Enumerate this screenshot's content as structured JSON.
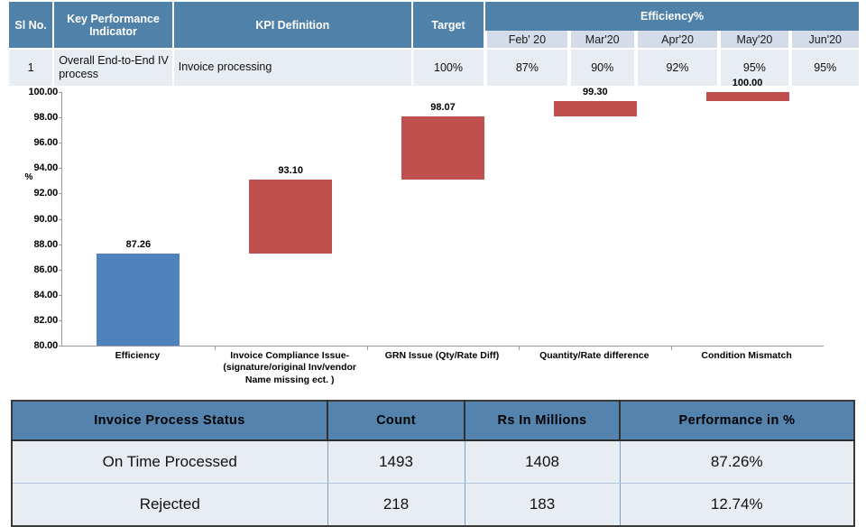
{
  "kpi_table": {
    "headers": {
      "sl_no": "Sl No.",
      "kpi": "Key Performance Indicator",
      "definition": "KPI Definition",
      "target": "Target",
      "efficiency_group": "Efficiency%"
    },
    "months": [
      "Feb' 20",
      "Mar'20",
      "Apr'20",
      "May'20",
      "Jun'20"
    ],
    "rows": [
      {
        "sl_no": "1",
        "kpi": "Overall End-to-End IV process",
        "definition": "Invoice processing",
        "target": "100%",
        "values": [
          "87%",
          "90%",
          "92%",
          "95%",
          "95%"
        ]
      }
    ]
  },
  "chart_data": {
    "type": "bar",
    "subtype": "waterfall",
    "title": "",
    "xlabel": "",
    "ylabel": "%",
    "ylim": [
      80.0,
      100.0
    ],
    "ytick_step": 2.0,
    "yticks": [
      "100.00",
      "98.00",
      "96.00",
      "94.00",
      "92.00",
      "90.00",
      "88.00",
      "86.00",
      "84.00",
      "82.00",
      "80.00"
    ],
    "grid": false,
    "legend": "none",
    "categories": [
      "Efficiency",
      "Invoice Compliance Issue-(signature/original Inv/vendor Name missing ect. )",
      "GRN Issue (Qty/Rate Diff)",
      "Quantity/Rate difference",
      "Condition Mismatch"
    ],
    "bars": [
      {
        "category": "Efficiency",
        "base": 80.0,
        "top": 87.26,
        "label": "87.26",
        "color": "#4F81BD",
        "kind": "total"
      },
      {
        "category": "Invoice Compliance Issue-(signature/original Inv/vendor Name missing ect. )",
        "base": 87.26,
        "top": 93.1,
        "label": "93.10",
        "color": "#C0504D",
        "kind": "delta"
      },
      {
        "category": "GRN Issue (Qty/Rate Diff)",
        "base": 93.1,
        "top": 98.07,
        "label": "98.07",
        "color": "#C0504D",
        "kind": "delta"
      },
      {
        "category": "Quantity/Rate difference",
        "base": 98.07,
        "top": 99.3,
        "label": "99.30",
        "color": "#C0504D",
        "kind": "delta"
      },
      {
        "category": "Condition Mismatch",
        "base": 99.3,
        "top": 100.0,
        "label": "100.00",
        "color": "#C0504D",
        "kind": "delta"
      }
    ],
    "values": [
      87.26,
      93.1,
      98.07,
      99.3,
      100.0
    ]
  },
  "status_table": {
    "columns": [
      "Invoice  Process  Status",
      "Count",
      "Rs In Millions",
      "Performance  in %"
    ],
    "rows": [
      {
        "status": "On Time Processed",
        "count": "1493",
        "rs_millions": "1408",
        "performance": "87.26%"
      },
      {
        "status": "Rejected",
        "count": "218",
        "rs_millions": "183",
        "performance": "12.74%"
      }
    ]
  },
  "colors": {
    "header_blue": "#4F81A9",
    "subheader_blue": "#D3DCE8",
    "cell_blue": "#E8ECF3",
    "bar_blue": "#4F81BD",
    "bar_red": "#C0504D",
    "status_header": "#5483AE"
  }
}
